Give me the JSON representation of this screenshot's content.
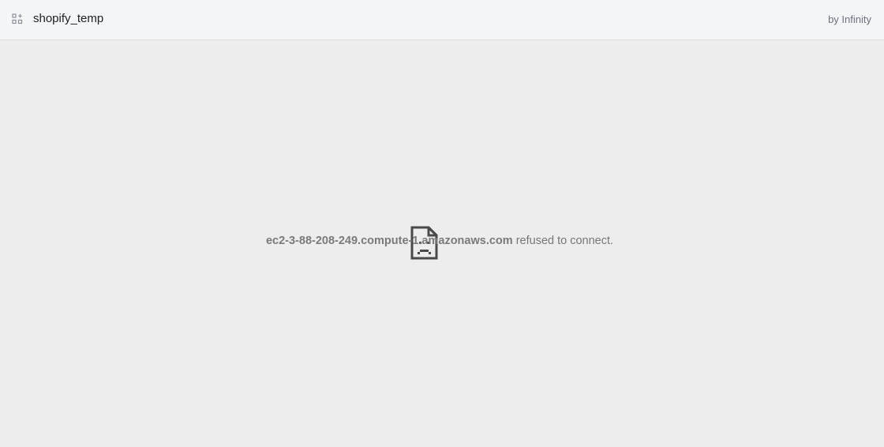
{
  "header": {
    "app_icon": "apps-grid-icon",
    "title": "shopify_temp",
    "byline": "by Infinity"
  },
  "error": {
    "icon": "sad-document-icon",
    "host": "ec2-3-88-208-249.compute-1.amazonaws.com",
    "message": "refused to connect."
  },
  "colors": {
    "header_bg": "#f4f5f7",
    "page_bg": "#ededed",
    "icon_stroke": "#4a4a4a",
    "message_text": "#777777"
  }
}
